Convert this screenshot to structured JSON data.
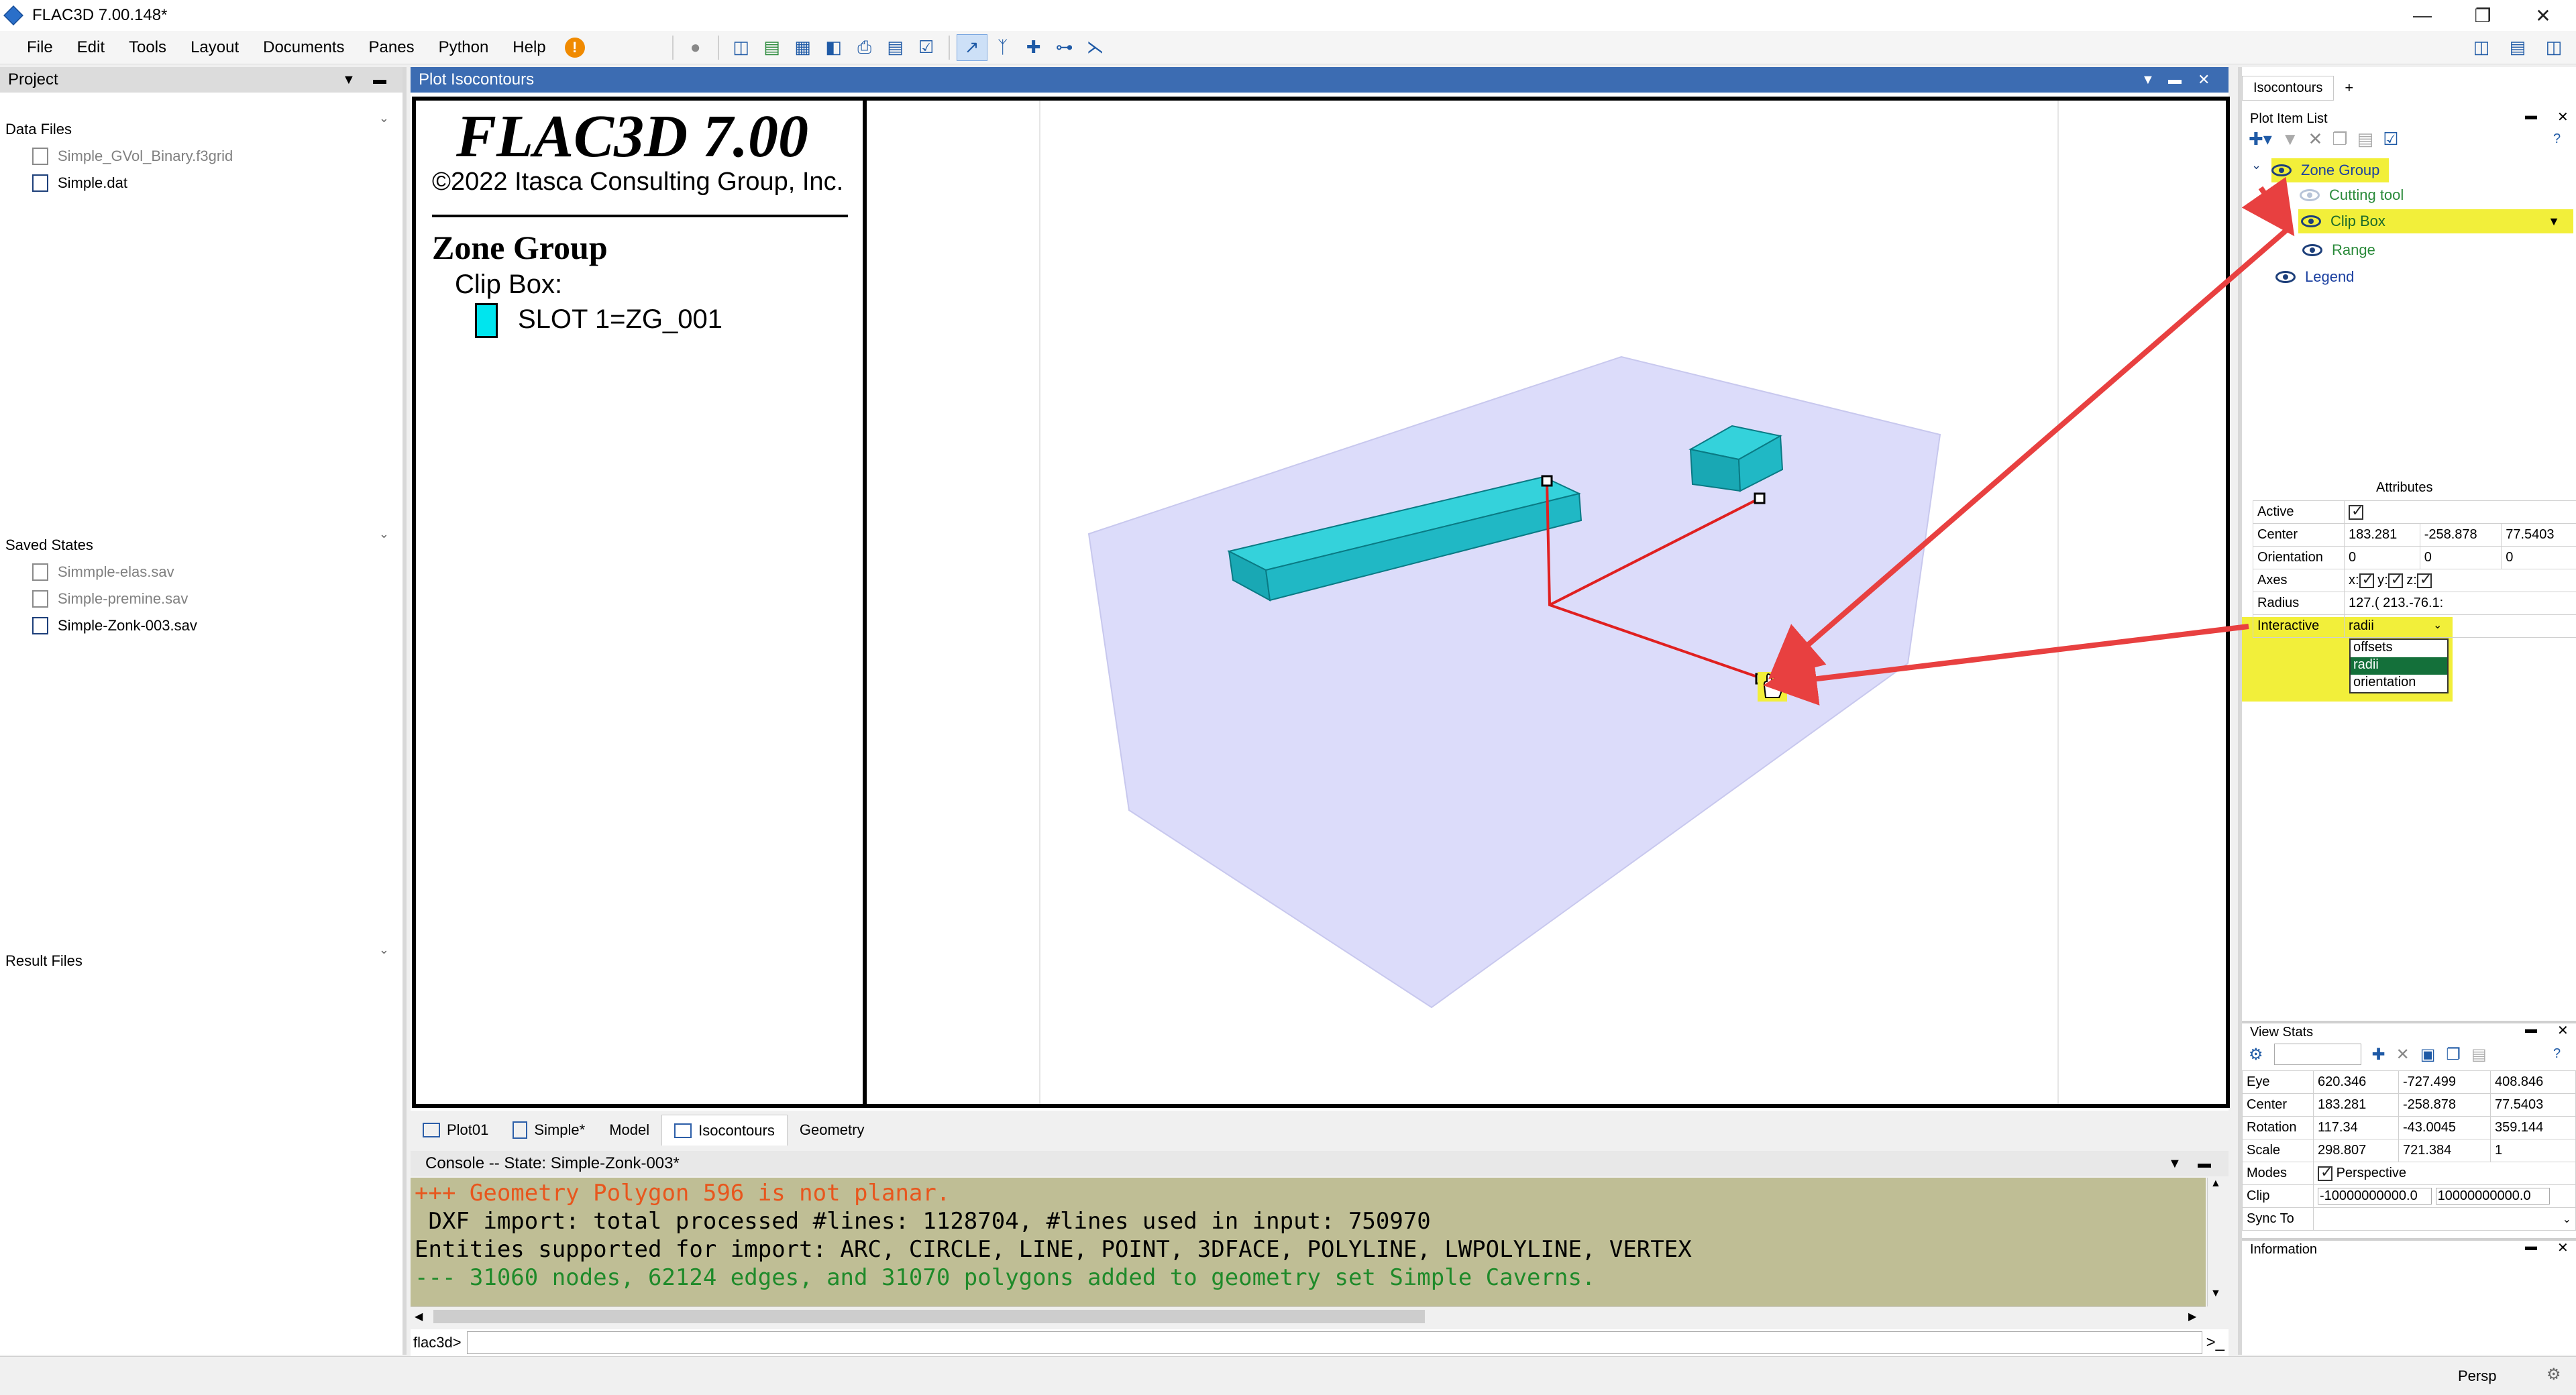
{
  "window": {
    "title": "FLAC3D 7.00.148*"
  },
  "menu": [
    "File",
    "Edit",
    "Tools",
    "Layout",
    "Documents",
    "Panes",
    "Python",
    "Help"
  ],
  "project": {
    "header": "Project",
    "data_files_label": "Data Files",
    "data_files": [
      "Simple_GVol_Binary.f3grid",
      "Simple.dat"
    ],
    "saved_states_label": "Saved States",
    "saved_states": [
      "Simmple-elas.sav",
      "Simple-premine.sav",
      "Simple-Zonk-003.sav"
    ],
    "result_files_label": "Result Files"
  },
  "plot": {
    "header": "Plot Isocontours",
    "legend": {
      "product": "FLAC3D 7.00",
      "copyright": "©2022 Itasca Consulting Group, Inc.",
      "heading": "Zone Group",
      "subheading": "Clip Box:",
      "item": "SLOT 1=ZG_001",
      "swatch_color": "#00e5ee"
    },
    "tabs": [
      "Plot01",
      "Simple*",
      "Model",
      "Isocontours",
      "Geometry"
    ],
    "selected_tab": "Isocontours"
  },
  "console": {
    "header": "Console -- State: Simple-Zonk-003*",
    "lines": [
      "+++ Geometry Polygon 596 is not planar.",
      " DXF import: total processed #lines: 1128704, #lines used in input: 750970",
      "Entities supported for import: ARC, CIRCLE, LINE, POINT, 3DFACE, POLYLINE, LWPOLYLINE, VERTEX",
      "--- 31060 nodes, 62124 edges, and 31070 polygons added to geometry set Simple Caverns."
    ],
    "prompt": "flac3d>",
    "run_symbol": ">_"
  },
  "right": {
    "tab": "Isocontours",
    "add_tab": "+",
    "plot_item_list_label": "Plot Item List",
    "tree": {
      "zone_group": "Zone Group",
      "cutting_tool": "Cutting tool",
      "clip_box": "Clip Box",
      "range": "Range",
      "legend": "Legend"
    },
    "attributes_label": "Attributes",
    "attributes": {
      "active_label": "Active",
      "center_label": "Center",
      "center": [
        "183.281",
        "-258.878",
        "77.5403"
      ],
      "orientation_label": "Orientation",
      "orientation": [
        "0",
        "0",
        "0"
      ],
      "axes_label": "Axes",
      "axes": [
        "x:",
        "y:",
        "z:"
      ],
      "radius_label": "Radius",
      "radius": "127.( 213.-76.1:",
      "interactive_label": "Interactive",
      "interactive": "radii",
      "interactive_options": [
        "offsets",
        "radii",
        "orientation"
      ]
    },
    "view_stats_label": "View Stats",
    "view_stats": {
      "eye_label": "Eye",
      "eye": [
        "620.346",
        "-727.499",
        "408.846"
      ],
      "center_label": "Center",
      "center": [
        "183.281",
        "-258.878",
        "77.5403"
      ],
      "rotation_label": "Rotation",
      "rotation": [
        "117.34",
        "-43.0045",
        "359.144"
      ],
      "scale_label": "Scale",
      "scale": [
        "298.807",
        "721.384",
        "1"
      ],
      "modes_label": "Modes",
      "perspective_label": "Perspective",
      "clip_label": "Clip",
      "clip": [
        "-10000000000.0",
        "10000000000.0"
      ],
      "sync_label": "Sync To"
    },
    "information_label": "Information"
  },
  "status": {
    "mode": "Persp"
  },
  "colors": {
    "accent": "#3c6cb2",
    "highlight": "#f2ef3a",
    "arrow": "#e84040",
    "model": "#1fb6c4",
    "console_bg": "#bfbe95"
  }
}
